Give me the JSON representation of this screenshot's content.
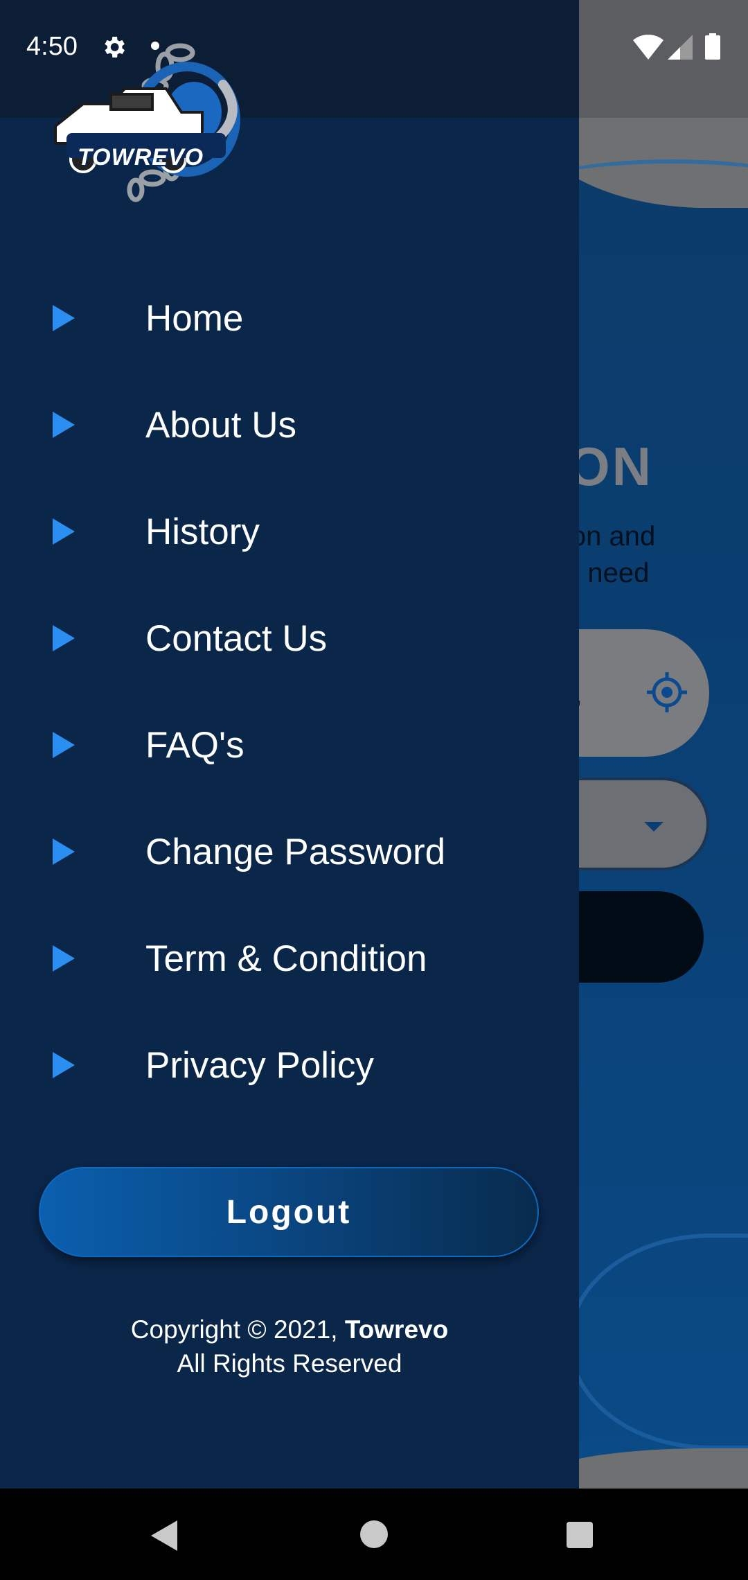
{
  "status_bar": {
    "time": "4:50",
    "icons": [
      "settings-icon",
      "notification-dot-icon",
      "wifi-icon",
      "signal-icon",
      "battery-icon"
    ]
  },
  "drawer": {
    "logo_text": "TOWREVO",
    "menu": [
      {
        "label": "Home",
        "icon": "play-arrow-icon"
      },
      {
        "label": "About Us",
        "icon": "play-arrow-icon"
      },
      {
        "label": "History",
        "icon": "play-arrow-icon"
      },
      {
        "label": "Contact Us",
        "icon": "play-arrow-icon"
      },
      {
        "label": "FAQ's",
        "icon": "play-arrow-icon"
      },
      {
        "label": "Change Password",
        "icon": "play-arrow-icon"
      },
      {
        "label": "Term & Condition",
        "icon": "play-arrow-icon"
      },
      {
        "label": "Privacy Policy",
        "icon": "play-arrow-icon"
      }
    ],
    "logout_label": "Logout",
    "copyright_prefix": "Copyright © 2021, ",
    "copyright_brand": "Towrevo",
    "copyright_line2": "All Rights Reserved"
  },
  "background_screen": {
    "heading_fragment": "ON",
    "subtitle_fragment": "ion and\nu need",
    "input_fragment": "y,",
    "icons": [
      "my-location-icon",
      "dropdown-caret-icon"
    ]
  },
  "colors": {
    "drawer_bg": "#0a2649",
    "accent": "#2b8ff2",
    "button_blue": "#0a5fae",
    "nav_bar": "#000000"
  }
}
